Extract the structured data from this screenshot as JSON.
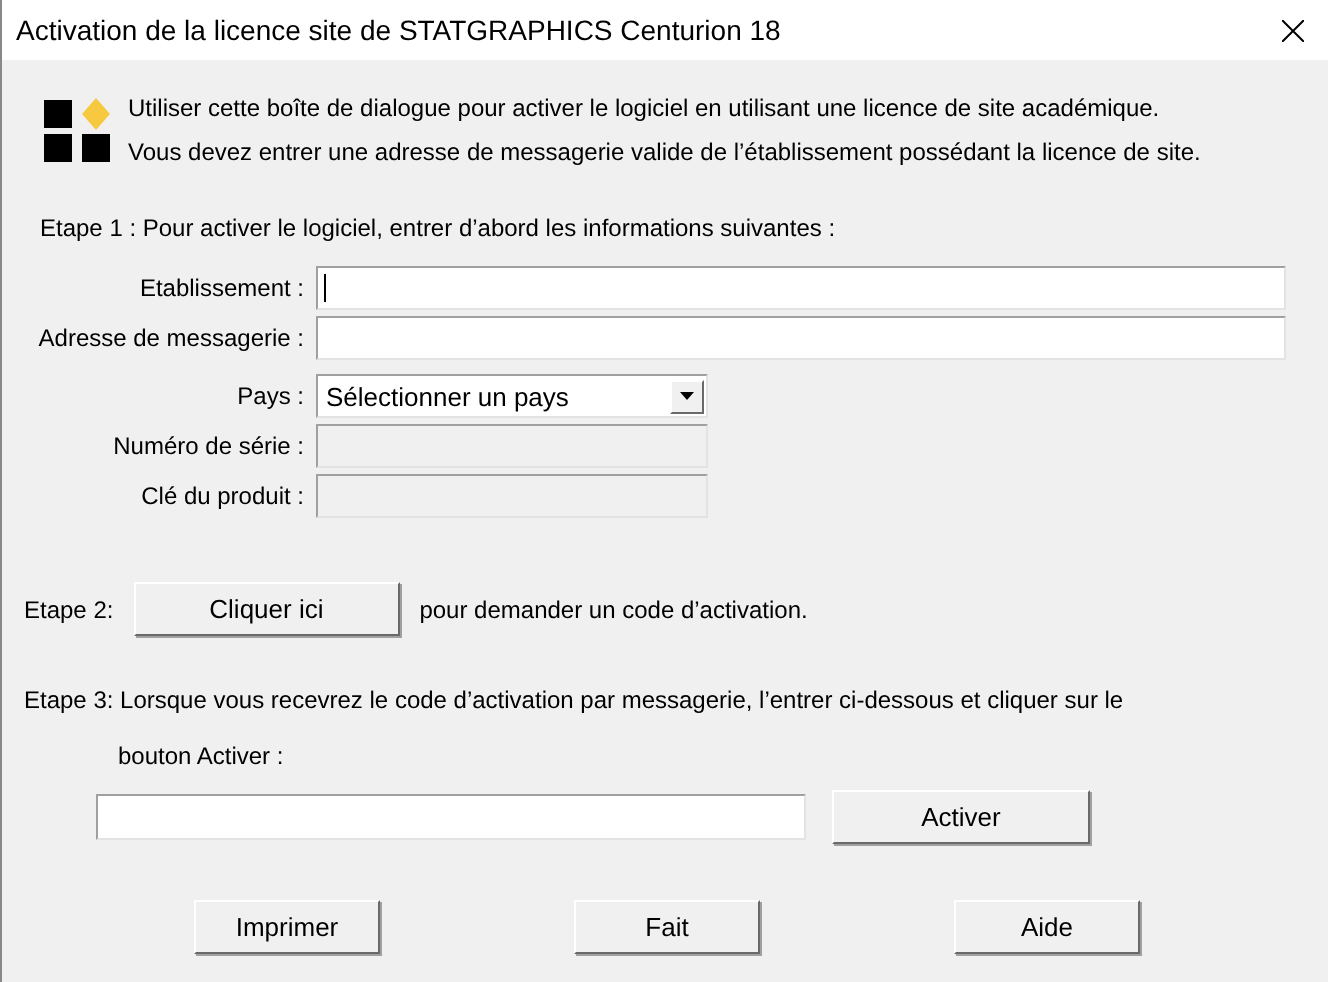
{
  "window": {
    "title": "Activation de la licence site de STATGRAPHICS Centurion 18"
  },
  "intro": [
    "Utiliser cette boîte de dialogue pour activer le logiciel en utilisant une licence de site académique.",
    "Vous devez entrer une adresse de messagerie valide de l’établissement possédant la licence de site."
  ],
  "step1": {
    "heading": "Etape 1 : Pour activer le logiciel, entrer d’abord les informations suivantes :",
    "fields": [
      {
        "kind": "text",
        "label": "Etablissement :",
        "wide": true,
        "disabled": false,
        "focused": true
      },
      {
        "kind": "text",
        "label": "Adresse de messagerie :",
        "wide": true,
        "disabled": false,
        "focused": false
      },
      {
        "kind": "select",
        "label": "Pays :",
        "value": "Sélectionner un pays"
      },
      {
        "kind": "text",
        "label": "Numéro de série :",
        "wide": false,
        "disabled": true,
        "focused": false
      },
      {
        "kind": "text",
        "label": "Clé du produit :",
        "wide": false,
        "disabled": true,
        "focused": false
      }
    ]
  },
  "step2": {
    "label": "Etape 2:",
    "button": "Cliquer ici",
    "text": "pour demander un code d’activation."
  },
  "step3": {
    "lines": [
      "Etape 3: Lorsque vous recevrez le code d’activation par messagerie, l’entrer ci-dessous et cliquer sur le",
      "bouton Activer :"
    ],
    "button": "Activer"
  },
  "buttons": [
    "Imprimer",
    "Fait",
    "Aide"
  ]
}
